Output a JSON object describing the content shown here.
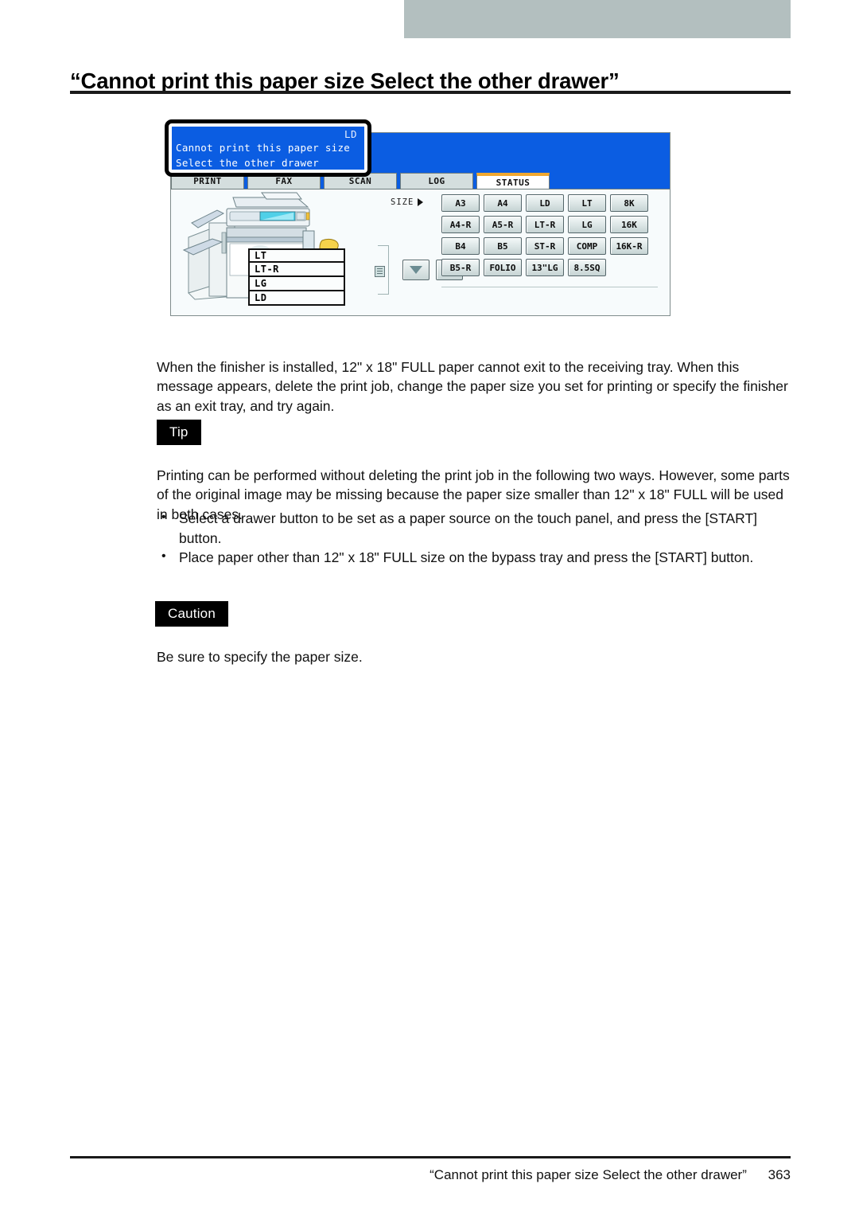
{
  "page": {
    "title": "“Cannot print this paper size  Select the other drawer”",
    "footer_title": "“Cannot print this paper size Select the other drawer”",
    "footer_page": "363"
  },
  "figure": {
    "callout": {
      "job_size": "LD",
      "line1": "Cannot print this paper size",
      "line2": "Select the other drawer"
    },
    "lcd": {
      "header_job": ":LD",
      "tabs": [
        {
          "label": "PRINT",
          "active": false
        },
        {
          "label": "FAX",
          "active": false
        },
        {
          "label": "SCAN",
          "active": false
        },
        {
          "label": "LOG",
          "active": false
        },
        {
          "label": "STATUS",
          "active": true
        }
      ],
      "size_label": "SIZE",
      "size_buttons": [
        [
          "A3",
          "A4",
          "LD",
          "LT",
          "8K"
        ],
        [
          "A4-R",
          "A5-R",
          "LT-R",
          "LG",
          "16K"
        ],
        [
          "B4",
          "B5",
          "ST-R",
          "COMP",
          "16K-R"
        ],
        [
          "B5-R",
          "FOLIO",
          "13\"LG",
          "8.5SQ"
        ]
      ],
      "drawers": [
        "LT",
        "LT-R",
        "LG",
        "LD"
      ],
      "scroll_down_icon": "arrow-down-icon",
      "scroll_up_icon": "arrow-up-icon"
    },
    "colors": {
      "lcd_blue": "#0b5de2",
      "active_tab_accent": "#f0a830",
      "header_bar_gray": "#b3bfbf"
    }
  },
  "content": {
    "intro": "When the finisher is installed, 12\" x 18\" FULL paper cannot exit to the receiving tray. When this message appears, delete the print job, change the paper size you set for printing or specify the finisher as an exit tray, and try again.",
    "tip_label": "Tip",
    "tip_text": "Printing can be performed without deleting the print job in the following two ways. However, some parts of the original image may be missing because the paper size smaller than 12\" x 18\" FULL will be used in both cases.",
    "bullets": [
      "Select a drawer button to be set as a paper source on the touch panel, and press the [START] button.",
      "Place paper other than 12\" x 18\" FULL size on the bypass tray and press the [START] button."
    ],
    "caution_label": "Caution",
    "caution_text": "Be sure to specify the paper size."
  }
}
